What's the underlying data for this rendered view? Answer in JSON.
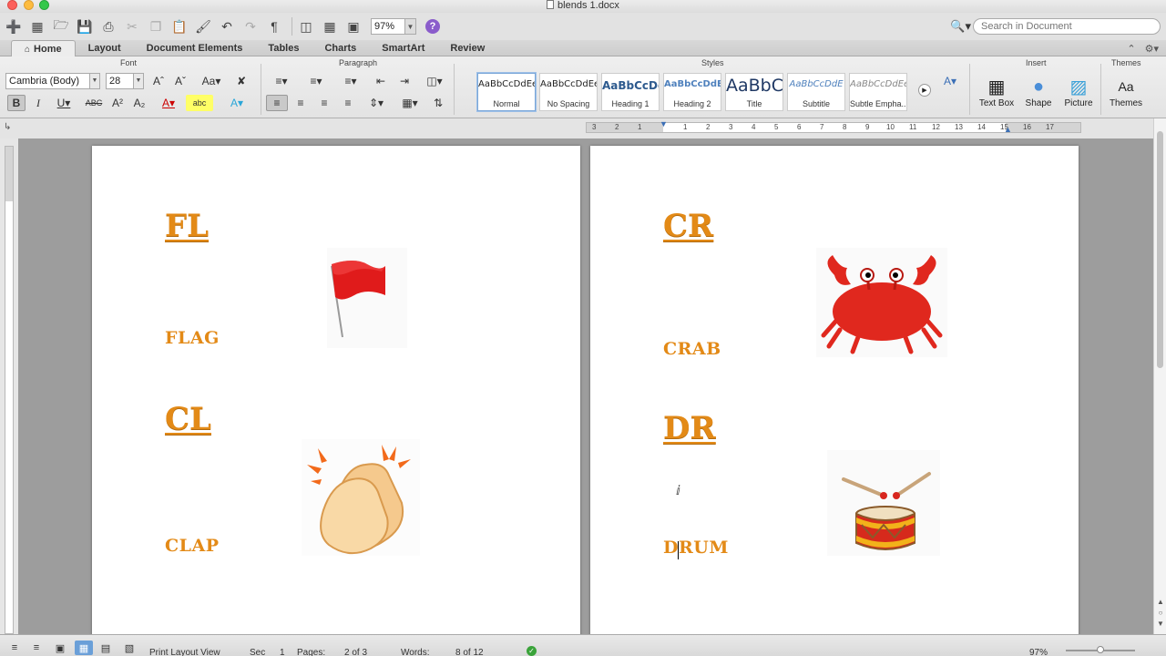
{
  "window": {
    "title": "blends 1.docx"
  },
  "search": {
    "placeholder": "Search in Document"
  },
  "quick_toolbar": {
    "zoom": "97%"
  },
  "ribbon_tabs": [
    {
      "label": "Home",
      "active": true
    },
    {
      "label": "Layout"
    },
    {
      "label": "Document Elements"
    },
    {
      "label": "Tables"
    },
    {
      "label": "Charts"
    },
    {
      "label": "SmartArt"
    },
    {
      "label": "Review"
    }
  ],
  "groups": {
    "font": "Font",
    "paragraph": "Paragraph",
    "styles": "Styles",
    "insert": "Insert",
    "themes": "Themes"
  },
  "font": {
    "name": "Cambria (Body)",
    "size": "28"
  },
  "styles": [
    {
      "sample": "AaBbCcDdEe",
      "name": "Normal",
      "selected": true
    },
    {
      "sample": "AaBbCcDdEe",
      "name": "No Spacing"
    },
    {
      "sample": "AaBbCcDc",
      "name": "Heading 1"
    },
    {
      "sample": "AaBbCcDdEe",
      "name": "Heading 2"
    },
    {
      "sample": "AaBbC",
      "name": "Title"
    },
    {
      "sample": "AaBbCcDdE",
      "name": "Subtitle"
    },
    {
      "sample": "AaBbCcDdEe",
      "name": "Subtle Empha..."
    }
  ],
  "insert": {
    "text_box": "Text Box",
    "shape": "Shape",
    "picture": "Picture",
    "themes": "Themes"
  },
  "document": {
    "page1": {
      "blend1": "FL",
      "word1": "FLAG",
      "blend2": "CL",
      "word2": "CLAP"
    },
    "page2": {
      "blend1": "CR",
      "word1": "CRAB",
      "blend2": "DR",
      "word2": "DRUM"
    }
  },
  "ruler": {
    "ticks": [
      "3",
      "2",
      "1",
      "1",
      "2",
      "3",
      "4",
      "5",
      "6",
      "7",
      "8",
      "9",
      "10",
      "11",
      "12",
      "13",
      "14",
      "15",
      "16",
      "17"
    ]
  },
  "statusbar": {
    "view": "Print Layout View",
    "sec_label": "Sec",
    "sec": "1",
    "pages_label": "Pages:",
    "pages": "2 of 3",
    "words_label": "Words:",
    "words": "8 of 12",
    "zoom": "97%"
  },
  "icons": [
    "new-doc-icon",
    "templates-icon",
    "open-icon",
    "save-icon",
    "print-icon",
    "cut-icon",
    "copy-icon",
    "paste-icon",
    "format-painter-icon",
    "undo-icon",
    "redo-icon",
    "pilcrow-icon",
    "sidebar-icon",
    "gallery-icon",
    "help-icon",
    "search-icon"
  ]
}
